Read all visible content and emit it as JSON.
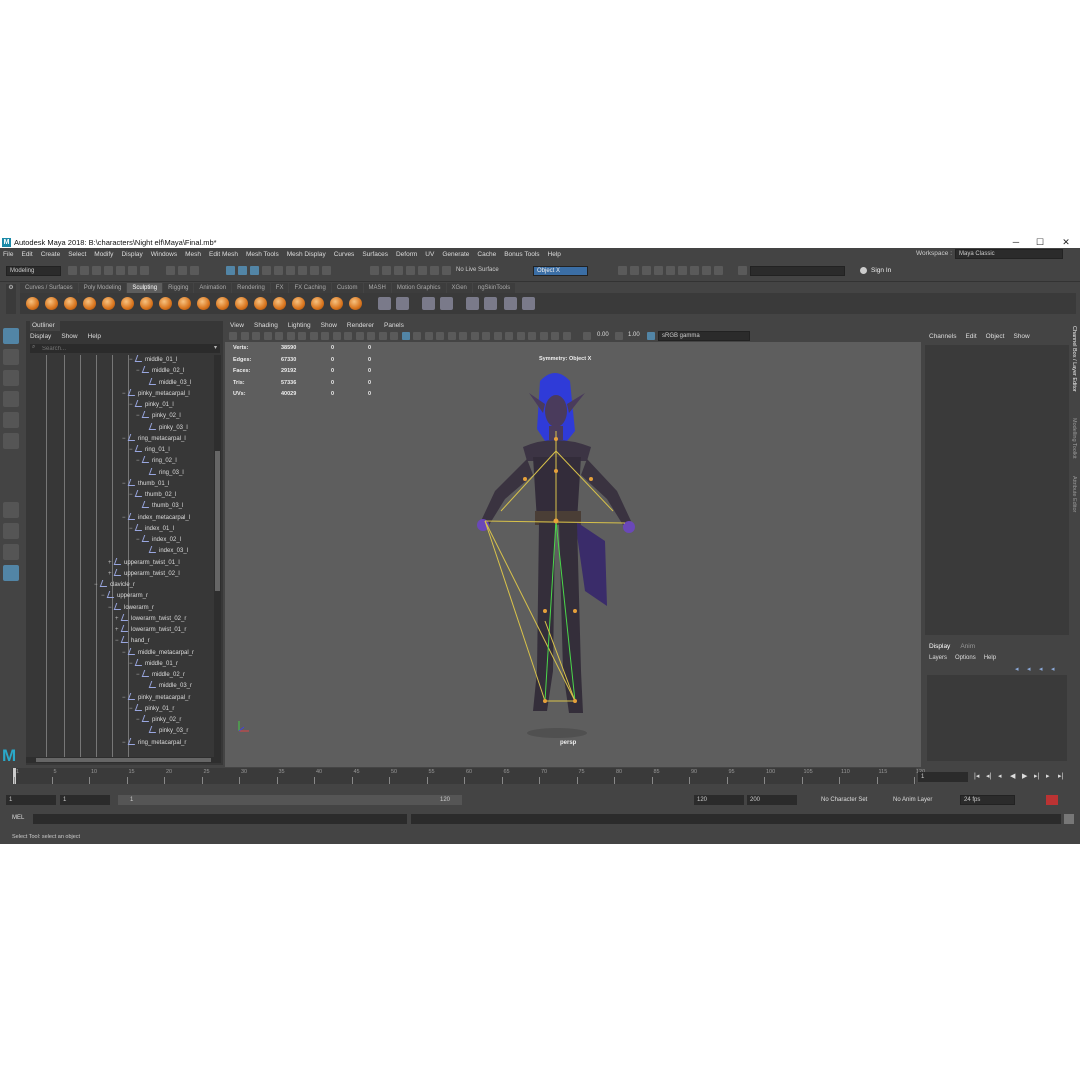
{
  "window": {
    "title": "Autodesk Maya 2018: B:\\characters\\Night elf\\Maya\\Final.mb*",
    "minimize": "─",
    "restore": "☐",
    "close": "✕"
  },
  "menus": [
    "File",
    "Edit",
    "Create",
    "Select",
    "Modify",
    "Display",
    "Windows",
    "Mesh",
    "Edit Mesh",
    "Mesh Tools",
    "Mesh Display",
    "Curves",
    "Surfaces",
    "Deform",
    "UV",
    "Generate",
    "Cache",
    "Bonus Tools",
    "Help"
  ],
  "workspace": {
    "label": "Workspace :",
    "value": "Maya Classic"
  },
  "status": {
    "mode": "Modeling",
    "live_surface": "No Live Surface",
    "symmetry": "Object X",
    "sign_in": "Sign In"
  },
  "shelf_tabs": [
    "Curves / Surfaces",
    "Poly Modeling",
    "Sculpting",
    "Rigging",
    "Animation",
    "Rendering",
    "FX",
    "FX Caching",
    "Custom",
    "MASH",
    "Motion Graphics",
    "XGen",
    "ngSkinTools"
  ],
  "shelf_active": "Sculpting",
  "outliner": {
    "title": "Outliner",
    "menu": [
      "Display",
      "Show",
      "Help"
    ],
    "search_placeholder": "Search...",
    "rows": [
      {
        "d": 5,
        "t": "middle_01_l",
        "ex": "−"
      },
      {
        "d": 6,
        "t": "middle_02_l",
        "ex": "−"
      },
      {
        "d": 7,
        "t": "middle_03_l",
        "ex": ""
      },
      {
        "d": 4,
        "t": "pinky_metacarpal_l",
        "ex": "−"
      },
      {
        "d": 5,
        "t": "pinky_01_l",
        "ex": "−"
      },
      {
        "d": 6,
        "t": "pinky_02_l",
        "ex": "−"
      },
      {
        "d": 7,
        "t": "pinky_03_l",
        "ex": ""
      },
      {
        "d": 4,
        "t": "ring_metacarpal_l",
        "ex": "−"
      },
      {
        "d": 5,
        "t": "ring_01_l",
        "ex": "−"
      },
      {
        "d": 6,
        "t": "ring_02_l",
        "ex": "−"
      },
      {
        "d": 7,
        "t": "ring_03_l",
        "ex": ""
      },
      {
        "d": 4,
        "t": "thumb_01_l",
        "ex": "−"
      },
      {
        "d": 5,
        "t": "thumb_02_l",
        "ex": "−"
      },
      {
        "d": 6,
        "t": "thumb_03_l",
        "ex": ""
      },
      {
        "d": 4,
        "t": "index_metacarpal_l",
        "ex": "−"
      },
      {
        "d": 5,
        "t": "index_01_l",
        "ex": "−"
      },
      {
        "d": 6,
        "t": "index_02_l",
        "ex": "−"
      },
      {
        "d": 7,
        "t": "index_03_l",
        "ex": ""
      },
      {
        "d": 2,
        "t": "upperarm_twist_01_l",
        "ex": "+"
      },
      {
        "d": 2,
        "t": "upperarm_twist_02_l",
        "ex": "+"
      },
      {
        "d": 0,
        "t": "clavicle_r",
        "ex": "−"
      },
      {
        "d": 1,
        "t": "upperarm_r",
        "ex": "−"
      },
      {
        "d": 2,
        "t": "lowerarm_r",
        "ex": "−"
      },
      {
        "d": 3,
        "t": "lowerarm_twist_02_r",
        "ex": "+"
      },
      {
        "d": 3,
        "t": "lowerarm_twist_01_r",
        "ex": "+"
      },
      {
        "d": 3,
        "t": "hand_r",
        "ex": "−"
      },
      {
        "d": 4,
        "t": "middle_metacarpal_r",
        "ex": "−"
      },
      {
        "d": 5,
        "t": "middle_01_r",
        "ex": "−"
      },
      {
        "d": 6,
        "t": "middle_02_r",
        "ex": "−"
      },
      {
        "d": 7,
        "t": "middle_03_r",
        "ex": ""
      },
      {
        "d": 4,
        "t": "pinky_metacarpal_r",
        "ex": "−"
      },
      {
        "d": 5,
        "t": "pinky_01_r",
        "ex": "−"
      },
      {
        "d": 6,
        "t": "pinky_02_r",
        "ex": "−"
      },
      {
        "d": 7,
        "t": "pinky_03_r",
        "ex": ""
      },
      {
        "d": 4,
        "t": "ring_metacarpal_r",
        "ex": "−"
      }
    ]
  },
  "viewport": {
    "menu": [
      "View",
      "Shading",
      "Lighting",
      "Show",
      "Renderer",
      "Panels"
    ],
    "exposure": "0.00",
    "gamma": "1.00",
    "colorspace": "sRGB gamma",
    "symmetry_label": "Symmetry: Object X",
    "camera": "persp",
    "stats": [
      {
        "k": "Verts:",
        "a": "38590",
        "b": "0",
        "c": "0"
      },
      {
        "k": "Edges:",
        "a": "67330",
        "b": "0",
        "c": "0"
      },
      {
        "k": "Faces:",
        "a": "29192",
        "b": "0",
        "c": "0"
      },
      {
        "k": "Tris:",
        "a": "57336",
        "b": "0",
        "c": "0"
      },
      {
        "k": "UVs:",
        "a": "40029",
        "b": "0",
        "c": "0"
      }
    ]
  },
  "channelbox": {
    "menu": [
      "Channels",
      "Edit",
      "Object",
      "Show"
    ],
    "side_tabs": [
      "Channel Box / Layer Editor",
      "Modelling Toolkit",
      "Attribute Editor"
    ]
  },
  "layers": {
    "tabs": [
      "Display",
      "Anim"
    ],
    "menu": [
      "Layers",
      "Options",
      "Help"
    ]
  },
  "timeline": {
    "ticks": [
      "1",
      "5",
      "10",
      "15",
      "20",
      "25",
      "30",
      "35",
      "40",
      "45",
      "50",
      "55",
      "60",
      "65",
      "70",
      "75",
      "80",
      "85",
      "90",
      "95",
      "100",
      "105",
      "110",
      "115",
      "120"
    ],
    "current": "1"
  },
  "range": {
    "start": "1",
    "start2": "1",
    "slider_start": "1",
    "slider_end": "120",
    "end": "120",
    "end2": "200",
    "charset": "No Character Set",
    "animlayer": "No Anim Layer",
    "fps": "24 fps"
  },
  "mel": {
    "label": "MEL"
  },
  "help": "Select Tool: select an object"
}
